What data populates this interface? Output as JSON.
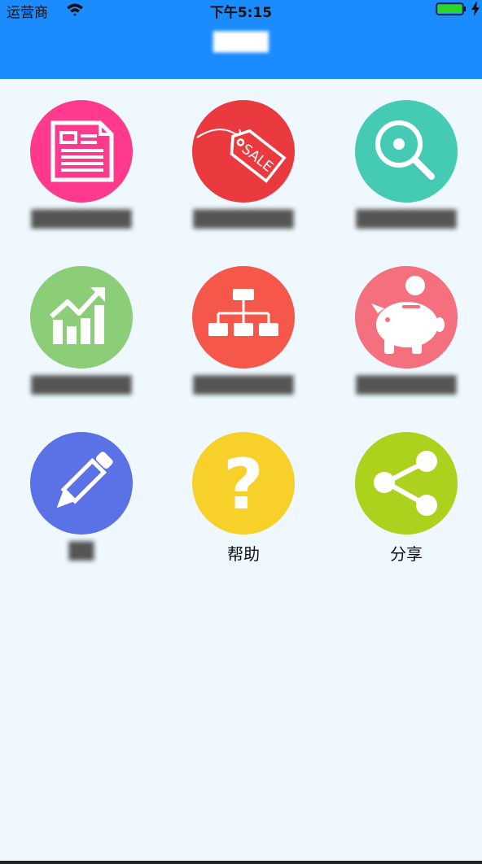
{
  "status_bar": {
    "carrier": "运营商",
    "time": "下午5:15"
  },
  "nav": {
    "title": "████"
  },
  "menu": {
    "items": [
      {
        "label": "████████",
        "color": "#ff3a8c",
        "icon": "newspaper-icon",
        "obscured": true
      },
      {
        "label": "████████",
        "color": "#ea3a3f",
        "icon": "sale-tag-icon",
        "obscured": true
      },
      {
        "label": "████████",
        "color": "#45cbb3",
        "icon": "magnifier-icon",
        "obscured": true
      },
      {
        "label": "████████",
        "color": "#8ccd78",
        "icon": "growth-chart-icon",
        "obscured": true
      },
      {
        "label": "████████",
        "color": "#f5584a",
        "icon": "org-chart-icon",
        "obscured": true
      },
      {
        "label": "████████",
        "color": "#f4707e",
        "icon": "piggy-bank-icon",
        "obscured": true
      },
      {
        "label": "██",
        "color": "#5b72e6",
        "icon": "pencil-icon",
        "obscured": true
      },
      {
        "label": "帮助",
        "color": "#f7d02a",
        "icon": "question-icon",
        "obscured": false
      },
      {
        "label": "分享",
        "color": "#acd21e",
        "icon": "share-icon",
        "obscured": false
      }
    ]
  },
  "colors": {
    "nav_background": "#1a8cff",
    "page_background": "#eef8fe",
    "battery_fill": "#2bd62b"
  }
}
